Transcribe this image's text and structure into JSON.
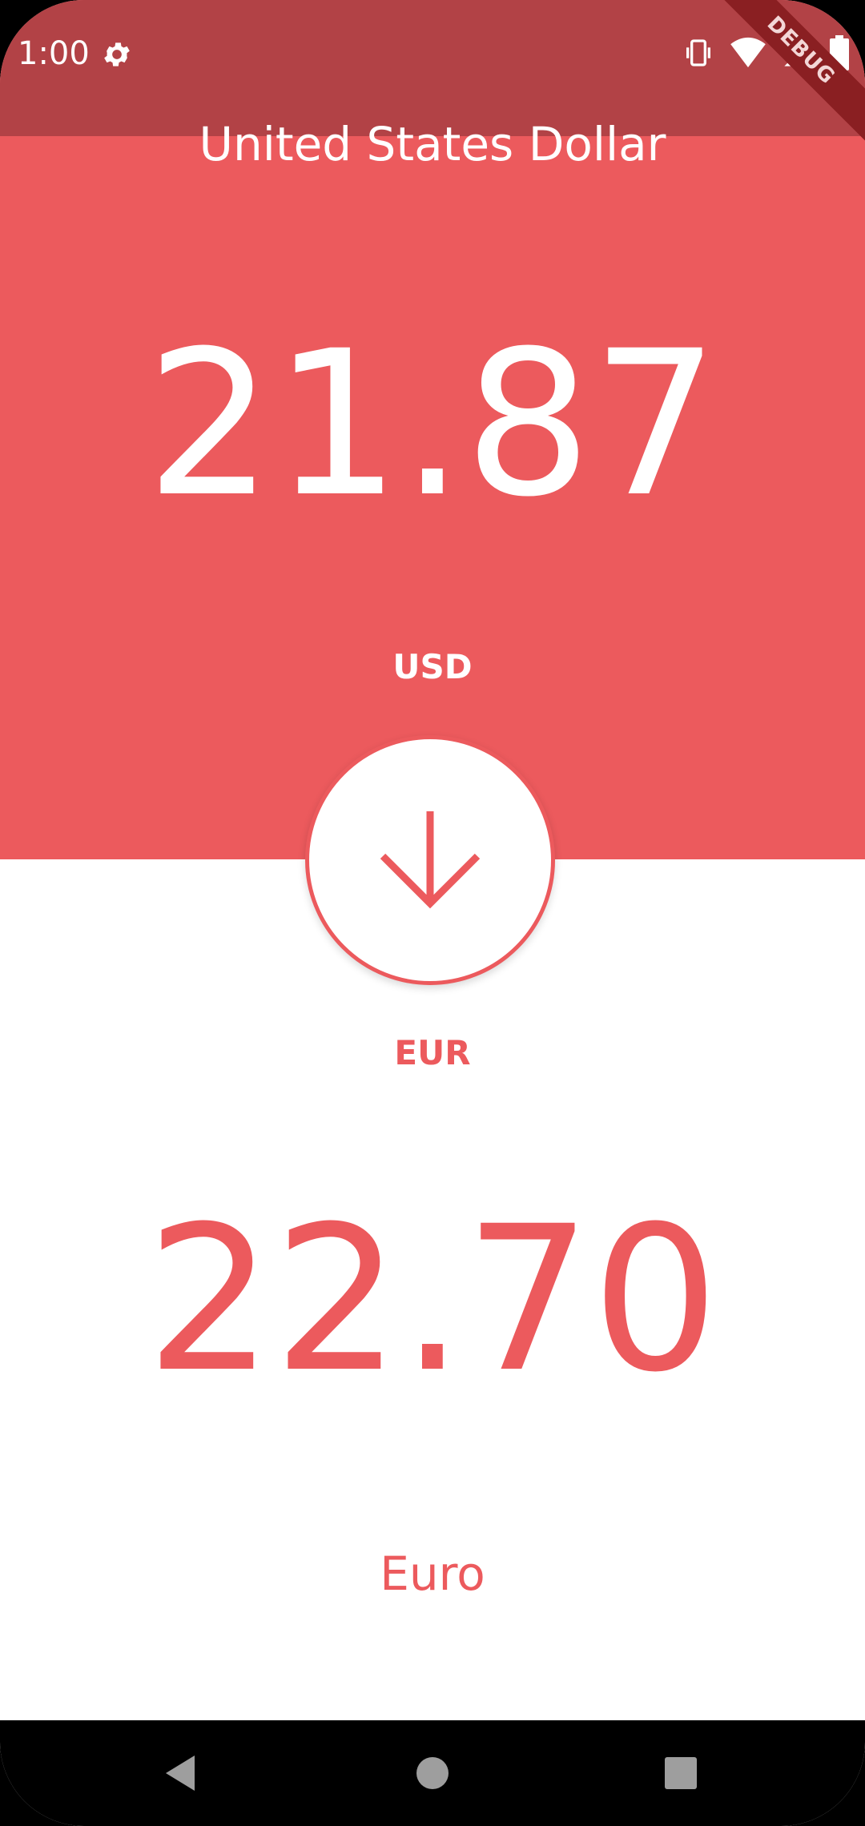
{
  "status_bar": {
    "time": "1:00",
    "icons": [
      "settings-icon",
      "vibrate-icon",
      "wifi-icon",
      "signal-icon",
      "battery-icon"
    ]
  },
  "debug_banner": "DEBUG",
  "from_currency": {
    "name": "United States Dollar",
    "amount": "21.87",
    "code": "USD"
  },
  "swap_button": {
    "icon": "arrow-down-icon"
  },
  "to_currency": {
    "code": "EUR",
    "amount": "22.70",
    "name": "Euro"
  },
  "nav": {
    "back_icon": "back-triangle-icon",
    "home_icon": "home-circle-icon",
    "recents_icon": "recents-square-icon"
  },
  "colors": {
    "accent": "#ec5a5d",
    "status_bar": "#b24246",
    "background": "#ffffff"
  }
}
